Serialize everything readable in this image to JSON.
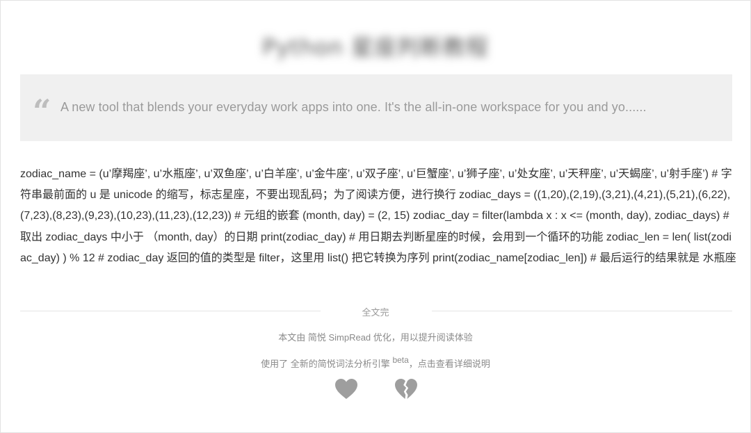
{
  "page": {
    "title": "Python 星座判断教程",
    "quote": "A new tool that blends your everyday work apps into one. It's the all-in-one workspace for you and yo......",
    "body": "zodiac_name = (u’摩羯座’, u’水瓶座’, u’双鱼座’, u’白羊座’, u’金牛座’, u’双子座’, u’巨蟹座’, u’狮子座’, u’处女座’, u’天秤座’, u’天蝎座’, u’射手座’) # 字符串最前面的 u 是 unicode 的缩写，标志星座，不要出现乱码；为了阅读方便，进行换行 zodiac_days = ((1,20),(2,19),(3,21),(4,21),(5,21),(6,22), (7,23),(8,23),(9,23),(10,23),(11,23),(12,23)) # 元组的嵌套 (month, day) = (2, 15) zodiac_day = filter(lambda x : x <= (month, day), zodiac_days) # 取出 zodiac_days 中小于 （month, day）的日期 print(zodiac_day) # 用日期去判断星座的时候，会用到一个循环的功能 zodiac_len = len( list(zodiac_day) ) % 12 # zodiac_day 返回的值的类型是 filter，这里用 list() 把它转换为序列 print(zodiac_name[zodiac_len]) # 最后运行的结果就是 水瓶座"
  },
  "footer": {
    "end_label": "全文完",
    "line1_prefix": "本文由",
    "line1_link": "简悦 SimpRead",
    "line1_suffix": "优化，用以提升阅读体验",
    "line2_prefix": "使用了",
    "line2_link": "全新的简悦词法分析引擎",
    "line2_sup": "beta",
    "line2_suffix": "，点击查看",
    "line2_link2": "详细说明"
  },
  "icons": {
    "like": "heart-icon",
    "unlike": "broken-heart-icon",
    "color": "#9e9e9e"
  }
}
